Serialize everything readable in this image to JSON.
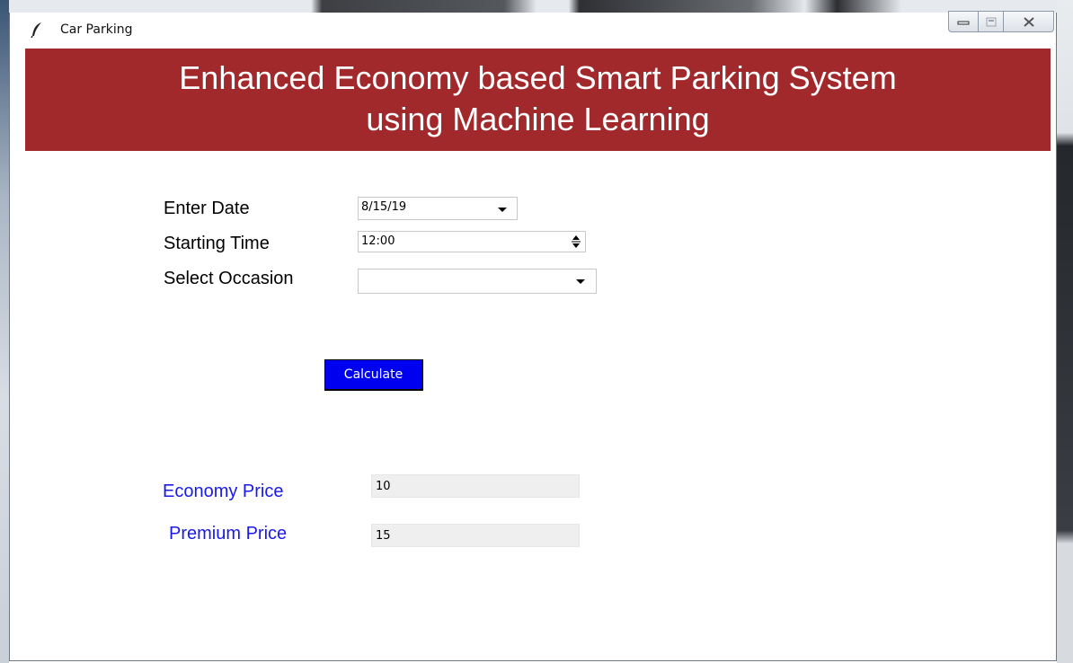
{
  "window": {
    "title": "Car Parking",
    "app_icon": "feather-icon",
    "controls": [
      "minimize-icon",
      "maximize-icon",
      "close-icon"
    ]
  },
  "banner": {
    "line1": "Enhanced Economy based Smart Parking System",
    "line2": "using Machine Learning",
    "background": "#a2292b"
  },
  "form": {
    "date_label": "Enter Date",
    "date_value": "8/15/19",
    "time_label": "Starting Time",
    "time_value": "12:00",
    "occasion_label": "Select Occasion",
    "occasion_value": ""
  },
  "actions": {
    "calculate_label": "Calculate",
    "calculate_color": "#0000f0"
  },
  "results": {
    "economy_label": "Economy Price",
    "economy_value": "10",
    "premium_label": "Premium Price",
    "premium_value": "15",
    "label_color": "#1a1ae6"
  }
}
